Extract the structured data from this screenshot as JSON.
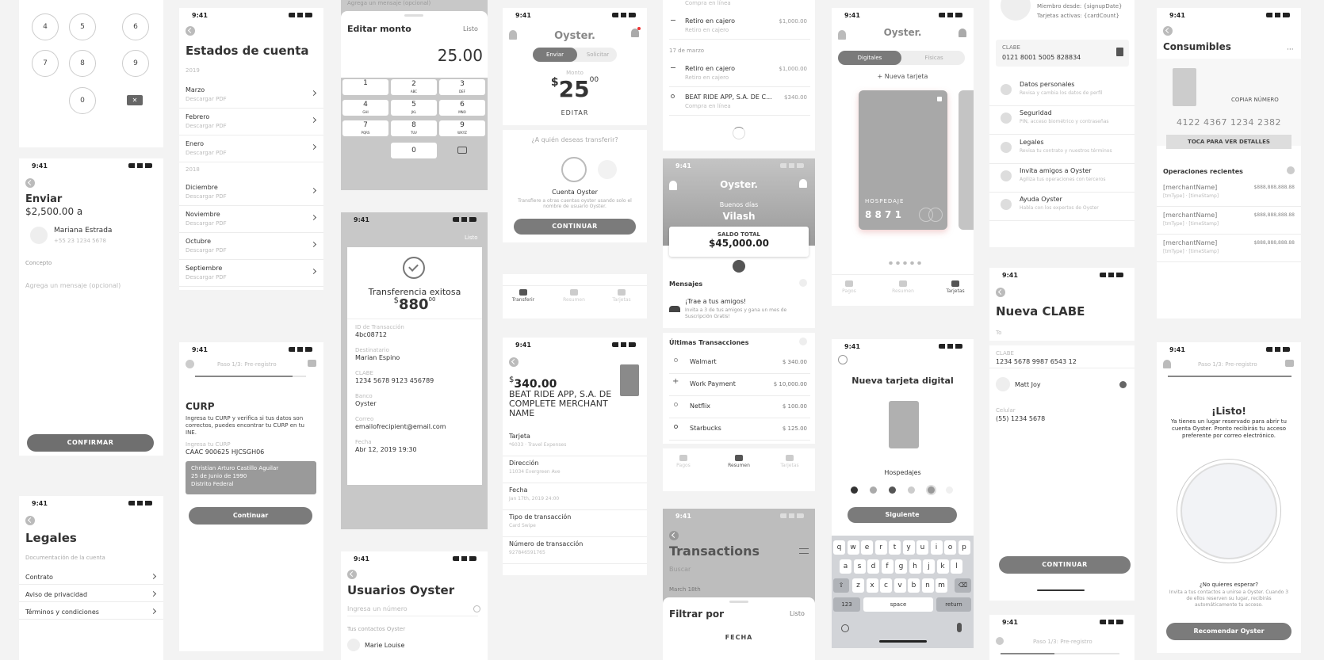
{
  "dialpad": {
    "keys": [
      "4",
      "5",
      "6",
      "7",
      "8",
      "9",
      "0"
    ]
  },
  "enviar": {
    "time": "9:41",
    "title": "Enviar",
    "amount": "$2,500.00",
    "a": "a",
    "name": "Mariana Estrada",
    "phone": "+55 23 1234 5678",
    "concepto_label": "Concepto",
    "placeholder": "Agrega un mensaje (opcional)",
    "confirm": "CONFIRMAR"
  },
  "legales": {
    "time": "9:41",
    "title": "Legales",
    "section": "Documentación de la cuenta",
    "items": [
      "Contrato",
      "Aviso de privacidad",
      "Términos y condiciones"
    ]
  },
  "estados": {
    "time": "9:41",
    "title": "Estados de cuenta",
    "year1": "2019",
    "items1": [
      "Marzo",
      "Febrero",
      "Enero"
    ],
    "year2": "2018",
    "items2": [
      "Diciembre",
      "Noviembre",
      "Octubre",
      "Septiembre"
    ],
    "sub": "Descargar PDF"
  },
  "curp": {
    "time": "9:41",
    "step": "Paso 1/3: Pre-registro",
    "title": "CURP",
    "desc": "Ingresa tu CURP y verifica si tus datos son correctos, puedes encontrar tu CURP en tu INE.",
    "field_label": "Ingresa tu CURP",
    "value": "CAAC 900625 HJCSGH06",
    "tip": [
      "Christian Arturo Castillo Aguilar",
      "25 de Junio de 1990",
      "Distrito Federal"
    ],
    "btn": "Continuar"
  },
  "editar": {
    "top": "Agrega un mensaje (opcional)",
    "title": "Editar monto",
    "done": "Listo",
    "amount": "25.00",
    "keys": [
      [
        "1",
        ""
      ],
      [
        "2",
        "ABC"
      ],
      [
        "3",
        "DEF"
      ],
      [
        "4",
        "GHI"
      ],
      [
        "5",
        "JKL"
      ],
      [
        "6",
        "MNO"
      ],
      [
        "7",
        "PQRS"
      ],
      [
        "8",
        "TUV"
      ],
      [
        "9",
        "WXYZ"
      ],
      [
        "0",
        ""
      ]
    ]
  },
  "exito": {
    "time": "9:41",
    "done": "Listo",
    "title": "Transferencia exitosa",
    "cur": "$",
    "amt": "880",
    "cents": "00",
    "fields": [
      [
        "ID de Transacción",
        "4bc08712"
      ],
      [
        "Destinatario",
        "Marian Espino"
      ],
      [
        "CLABE",
        "1234 5678 9123 456789"
      ],
      [
        "Banco",
        "Oyster"
      ],
      [
        "Correo",
        "emailofrecipient@email.com"
      ],
      [
        "Fecha",
        "Abr 12, 2019 19:30"
      ]
    ]
  },
  "usuarios": {
    "time": "9:41",
    "title": "Usuarios Oyster",
    "placeholder": "Ingresa un número",
    "section": "Tus contactos Oyster",
    "contact": "Marie Louise"
  },
  "transferir": {
    "time": "9:41",
    "brand": "Oyster.",
    "tab1": "Enviar",
    "tab2": "Solicitar",
    "monto": "Monto",
    "cur": "$",
    "amt": "25",
    "cents": "00",
    "edit": "EDITAR",
    "question": "¿A quién deseas transferir?",
    "opt": "Cuenta Oyster",
    "optdesc": "Transfiere a otras cuentas oyster usando solo el nombre de usuario Oyster.",
    "btn": "CONTINUAR",
    "nav": [
      "Transferir",
      "Resumen",
      "Tarjetas"
    ]
  },
  "detalle": {
    "time": "9:41",
    "cur": "$",
    "amount": "340.00",
    "merchant": "BEAT RIDE APP, S.A. DE COMPLETE MERCHANT NAME",
    "fields": [
      [
        "Tarjeta",
        "*6033 · Travel Expenses"
      ],
      [
        "Dirección",
        "11034 Evergreen Ave"
      ],
      [
        "Fecha",
        "Jan 17th, 2019 24:00"
      ],
      [
        "Tipo de transacción",
        "Card Swipe"
      ],
      [
        "Número de transacción",
        "927846591765"
      ]
    ]
  },
  "retiros": {
    "top": "Compra en línea",
    "rows": [
      [
        "Retiro en cajero",
        "Retiro en cajero",
        "$1,000.00"
      ],
      [
        "Retiro en cajero",
        "Retiro en cajero",
        "$1,000.00"
      ],
      [
        "BEAT RIDE APP, S.A. DE C...",
        "Compra en línea",
        "$340.00"
      ]
    ],
    "date": "17 de marzo"
  },
  "resumen": {
    "time": "9:41",
    "brand": "Oyster.",
    "greet": "Buenos días",
    "name": "Vilash",
    "saldo": "SALDO TOTAL",
    "total": "$45,000.00",
    "msgs": "Mensajes",
    "promo_t": "¡Trae a tus amigos!",
    "promo_d": "Invita a 3 de tus amigos y gana un mes de Suscripción Gratis!",
    "ult": "Últimas Transacciones",
    "tx": [
      [
        "Walmart",
        "$ 340.00"
      ],
      [
        "Work Payment",
        "$ 10,000.00"
      ],
      [
        "Netflix",
        "$ 100.00"
      ],
      [
        "Starbucks",
        "$ 125.00"
      ]
    ],
    "nav": [
      "Pagos",
      "Resumen",
      "Tarjetas"
    ]
  },
  "filtrar": {
    "time": "9:41",
    "title": "Transactions",
    "search": "Buscar",
    "date": "March 18th",
    "sheet": "Filtrar por",
    "done": "Listo",
    "fecha": "FECHA"
  },
  "tarjetas": {
    "time": "9:41",
    "brand": "Oyster.",
    "tab1": "Digitales",
    "tab2": "Físicas",
    "new": "+ Nueva tarjeta",
    "card": "HOSPEDAJE",
    "digits": "8 8 7 1",
    "nav": [
      "Pagos",
      "Resumen",
      "Tarjetas"
    ]
  },
  "nuevatarjeta": {
    "time": "9:41",
    "title": "Nueva tarjeta digital",
    "name": "Hospedajes",
    "btn": "Siguiente",
    "rows": [
      [
        "q",
        "w",
        "e",
        "r",
        "t",
        "y",
        "u",
        "i",
        "o",
        "p"
      ],
      [
        "a",
        "s",
        "d",
        "f",
        "g",
        "h",
        "j",
        "k",
        "l"
      ],
      [
        "z",
        "x",
        "c",
        "v",
        "b",
        "n",
        "m"
      ]
    ],
    "k123": "123",
    "space": "space",
    "ret": "return"
  },
  "perfil": {
    "member": "Miembro desde: {signupDate}",
    "cards": "Tarjetas activas: {cardCount}",
    "clabe_l": "CLABE",
    "clabe": "0121 8001 5005 828834",
    "items": [
      [
        "Datos personales",
        "Revisa y cambia los datos de perfil"
      ],
      [
        "Seguridad",
        "PIN, acceso biométrico y contraseñas"
      ],
      [
        "Legales",
        "Revisa tu contrato y nuestros términos"
      ],
      [
        "Invita amigos a Oyster",
        "Agiliza tus operaciones con terceros"
      ],
      [
        "Ayuda Oyster",
        "Habla con los expertos de Oyster"
      ]
    ]
  },
  "clabe": {
    "time": "9:41",
    "title": "Nueva CLABE",
    "to": "To",
    "clabe_l": "CLABE",
    "clabe": "1234 5678 9987 6543 12",
    "user": "Matt Joy",
    "cel_l": "Celular",
    "cel": "(55) 1234 5678",
    "btn": "CONTINUAR"
  },
  "consumibles": {
    "time": "9:41",
    "title": "Consumibles",
    "copy": "COPIAR NÚMERO",
    "number": "4122 4367 1234 2382",
    "tap": "TOCA PARA VER DETALLES",
    "ops": "Operaciones recientes",
    "rows": [
      [
        "[merchantName]",
        "[tmType] · [timeStamp]",
        "$888,888,888.88"
      ],
      [
        "[merchantName]",
        "[tmType] · [timeStamp]",
        "$888,888,888.88"
      ],
      [
        "[merchantName]",
        "[tmType] · [timeStamp]",
        "$888,888,888.88"
      ]
    ]
  },
  "listo": {
    "time": "9:41",
    "step": "Paso 1/3: Pre-registro",
    "title": "¡Listo!",
    "desc": "Ya tienes un lugar reservado para abrir tu cuenta Oyster. Pronto recibirás tu acceso preferente por correo electrónico.",
    "q": "¿No quieres esperar?",
    "qd": "Invita a tus contactos a unirse a Oyster. Cuando 3 de ellos reserven su lugar, recibirás automáticamente tu acceso.",
    "btn": "Recomendar Oyster"
  },
  "bottom": {
    "time": "9:41",
    "step": "Paso 1/3: Pre-registro"
  }
}
